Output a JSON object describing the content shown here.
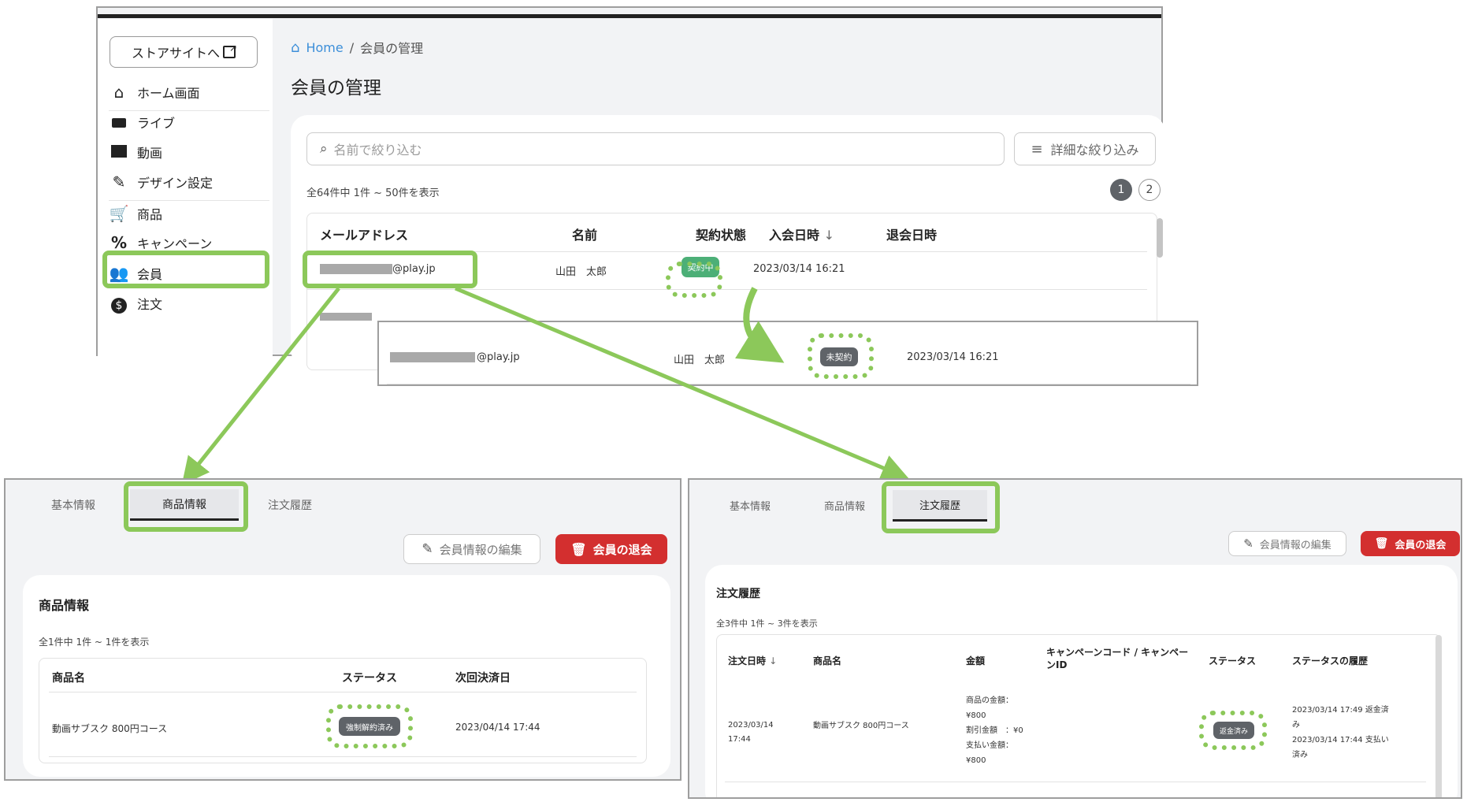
{
  "sidebar": {
    "store_button": "ストアサイトへ",
    "items": [
      {
        "label": "ホーム画面",
        "icon": "home-icon"
      },
      {
        "label": "ライブ",
        "icon": "video-camera-icon"
      },
      {
        "label": "動画",
        "icon": "clapperboard-icon"
      },
      {
        "label": "デザイン設定",
        "icon": "brush-icon"
      },
      {
        "label": "商品",
        "icon": "cart-icon"
      },
      {
        "label": "キャンペーン",
        "icon": "percent-icon"
      },
      {
        "label": "会員",
        "icon": "people-icon"
      },
      {
        "label": "注文",
        "icon": "dollar-icon"
      }
    ]
  },
  "breadcrumb": {
    "home": "Home",
    "separator": "/",
    "current": "会員の管理"
  },
  "page_title": "会員の管理",
  "search": {
    "placeholder": "名前で絞り込む"
  },
  "filter_button": "詳細な絞り込み",
  "list_count": "全64件中 1件 ~ 50件を表示",
  "pagination": {
    "page1": "1",
    "page2": "2"
  },
  "member_table": {
    "headers": {
      "email": "メールアドレス",
      "name": "名前",
      "status": "契約状態",
      "joined": "入会日時",
      "left": "退会日時"
    },
    "row": {
      "email_domain": "@play.jp",
      "name": "山田　太郎",
      "status": "契約中",
      "joined": "2023/03/14 16:21"
    }
  },
  "inset_row": {
    "email_domain": "@play.jp",
    "name": "山田　太郎",
    "status": "未契約",
    "joined": "2023/03/14 16:21"
  },
  "product_panel": {
    "tabs": [
      "基本情報",
      "商品情報",
      "注文履歴"
    ],
    "edit_button": "会員情報の編集",
    "withdraw_button": "会員の退会",
    "card_title": "商品情報",
    "count": "全1件中 1件 ~ 1件を表示",
    "headers": {
      "product": "商品名",
      "status": "ステータス",
      "next": "次回決済日"
    },
    "row": {
      "product": "動画サブスク 800円コース",
      "status": "強制解約済み",
      "next": "2023/04/14 17:44"
    }
  },
  "order_panel": {
    "tabs": [
      "基本情報",
      "商品情報",
      "注文履歴"
    ],
    "edit_button": "会員情報の編集",
    "withdraw_button": "会員の退会",
    "card_title": "注文履歴",
    "count": "全3件中 1件 ~ 3件を表示",
    "headers": {
      "date": "注文日時",
      "product": "商品名",
      "amount": "金額",
      "campaign": "キャンペーンコード / キャンペーンID",
      "status": "ステータス",
      "history": "ステータスの履歴"
    },
    "row": {
      "date": "2023/03/14 17:44",
      "product": "動画サブスク 800円コース",
      "amount_lines": [
        "商品の金額：",
        "¥800",
        "割引金額　：¥0",
        "支払い金額：",
        "¥800"
      ],
      "status": "返金済み",
      "history_lines": [
        "2023/03/14 17:49 返金済み",
        "2023/03/14 17:44 支払い済み"
      ]
    }
  },
  "colors": {
    "highlight": "#8cc85a",
    "link": "#3d8fd9",
    "danger": "#d32f2f",
    "active_status": "#4caf77",
    "inactive_status": "#5f6368"
  }
}
